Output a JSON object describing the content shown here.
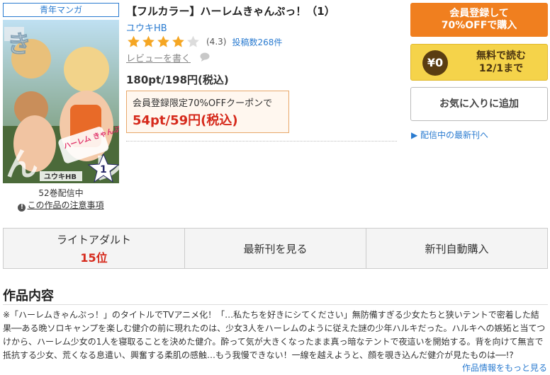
{
  "genre_badge": "青年マンガ",
  "cover": {
    "series_art_text": "ハーレム きゃんぷっ",
    "author_art_text": "ユウキHB",
    "volume_art_text": "1"
  },
  "volume_count": "52巻配信中",
  "notice": {
    "icon": "exclamation-icon",
    "label": "この作品の注意事項"
  },
  "title": "【フルカラー】ハーレムきゃんぷっ！（1）",
  "author": "ユウキHB",
  "rating": {
    "value": 4.3,
    "stars_filled": 4,
    "stars_total": 5,
    "value_label": "(4.3)",
    "reviews_label": "投稿数268件",
    "star_color": "#f5a623"
  },
  "write_review": "レビューを書く",
  "price": "180pt/198円(税込)",
  "coupon": {
    "label": "会員登録限定70%OFFクーポンで",
    "price": "54pt/59円(税込)"
  },
  "buttons": {
    "register_line1": "会員登録して",
    "register_line2": "70%OFFで購入",
    "free_coin": "¥0",
    "free_line1": "無料で読む",
    "free_line2": "12/1まで",
    "favorite": "お気に入りに追加",
    "latest_link": "▶ 配信中の最新刊へ"
  },
  "actions": [
    {
      "label": "ライトアダルト",
      "rank": "15位"
    },
    {
      "label": "最新刊を見る"
    },
    {
      "label": "新刊自動購入"
    }
  ],
  "section_title": "作品内容",
  "description": "※「ハーレムきゃんぷっ！」のタイトルでTVアニメ化！「…私たちを好きにシてください」無防備すぎる少女たちと狭いテントで密着した結果──ある晩ソロキャンプを楽しむ健介の前に現れたのは、少女3人をハーレムのように従えた謎の少年ハルキだった。ハルキへの嫉妬と当てつけから、ハーレム少女の1人を寝取ることを決めた健介。酔って気が大きくなったまま真っ暗なテントで夜這いを開始する。背を向けて無言で抵抗する少女、荒くなる息遣い、興奮する柔肌の感触…もう我慢できない！一線を越えようと、顔を覗き込んだ健介が見たものは──!?",
  "more_link": "作品情報をもっと見る",
  "colors": {
    "accent_orange": "#f07f1f",
    "free_yellow": "#f5d34a",
    "link_blue": "#2a7bd0",
    "price_red": "#d62a1c"
  }
}
